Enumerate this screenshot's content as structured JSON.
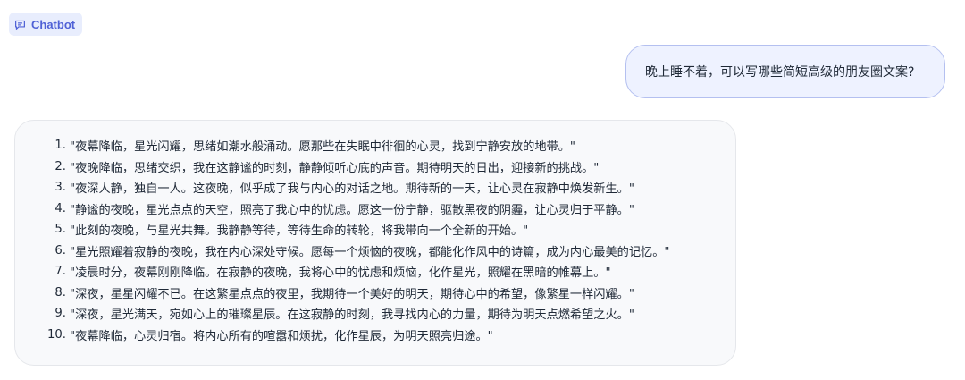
{
  "header": {
    "label": "Chatbot",
    "icon": "chat-bubble-icon",
    "accent_color": "#4f61d6"
  },
  "messages": {
    "user": {
      "text": "晚上睡不着，可以写哪些简短高级的朋友圈文案?"
    },
    "bot": {
      "items": [
        {
          "num": "1.",
          "text": "\"夜幕降临，星光闪耀，思绪如潮水般涌动。愿那些在失眠中徘徊的心灵，找到宁静安放的地带。\""
        },
        {
          "num": "2.",
          "text": "\"夜晚降临，思绪交织，我在这静谧的时刻，静静倾听心底的声音。期待明天的日出，迎接新的挑战。\""
        },
        {
          "num": "3.",
          "text": "\"夜深人静，独自一人。这夜晚，似乎成了我与内心的对话之地。期待新的一天，让心灵在寂静中焕发新生。\""
        },
        {
          "num": "4.",
          "text": "\"静谧的夜晚，星光点点的天空，照亮了我心中的忧虑。愿这一份宁静，驱散黑夜的阴霾，让心灵归于平静。\""
        },
        {
          "num": "5.",
          "text": "\"此刻的夜晚，与星光共舞。我静静等待，等待生命的转轮，将我带向一个全新的开始。\""
        },
        {
          "num": "6.",
          "text": "\"星光照耀着寂静的夜晚，我在内心深处守候。愿每一个烦恼的夜晚，都能化作风中的诗篇，成为内心最美的记忆。\""
        },
        {
          "num": "7.",
          "text": "\"凌晨时分，夜幕刚刚降临。在寂静的夜晚，我将心中的忧虑和烦恼，化作星光，照耀在黑暗的帷幕上。\""
        },
        {
          "num": "8.",
          "text": "\"深夜，星星闪耀不已。在这繁星点点的夜里，我期待一个美好的明天，期待心中的希望，像繁星一样闪耀。\""
        },
        {
          "num": "9.",
          "text": "\"深夜，星光满天，宛如心上的璀璨星辰。在这寂静的时刻，我寻找内心的力量，期待为明天点燃希望之火。\""
        },
        {
          "num": "10.",
          "text": "\"夜幕降临，心灵归宿。将内心所有的喧嚣和烦扰，化作星辰，为明天照亮归途。\""
        }
      ]
    }
  }
}
